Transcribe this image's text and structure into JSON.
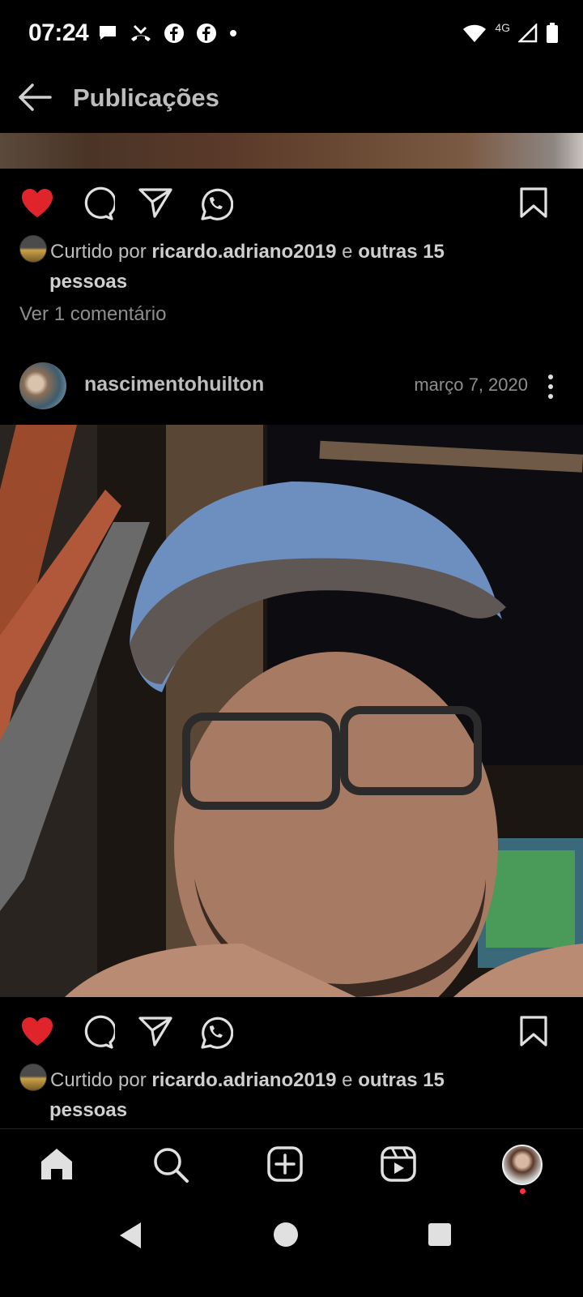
{
  "status_bar": {
    "time": "07:24",
    "network": "4G",
    "notification_icons": [
      "chat-bubble-icon",
      "missed-call-icon",
      "facebook-icon",
      "facebook-icon",
      "dot-icon"
    ]
  },
  "header": {
    "title": "Publicações"
  },
  "post1": {
    "liked_by_prefix": "Curtido por ",
    "liked_by_user": "ricardo.adriano2019",
    "liked_by_mid": " e ",
    "liked_by_others": "outras 15",
    "liked_by_suffix": "pessoas",
    "view_comments": "Ver 1 comentário",
    "liked": true
  },
  "post2": {
    "username": "nascimentohuilton",
    "date": "março 7, 2020",
    "liked_by_prefix": "Curtido por ",
    "liked_by_user": "ricardo.adriano2019",
    "liked_by_mid": " e ",
    "liked_by_others": "outras 15",
    "liked_by_suffix": "pessoas",
    "liked": true
  },
  "colors": {
    "like_red": "#e0242b",
    "background": "#000000",
    "notification_dot": "#ff3040"
  },
  "bottom_nav": [
    "home-icon",
    "search-icon",
    "new-post-icon",
    "reels-icon",
    "profile-avatar"
  ],
  "system_nav": [
    "back-icon",
    "home-circle-icon",
    "recents-icon"
  ]
}
